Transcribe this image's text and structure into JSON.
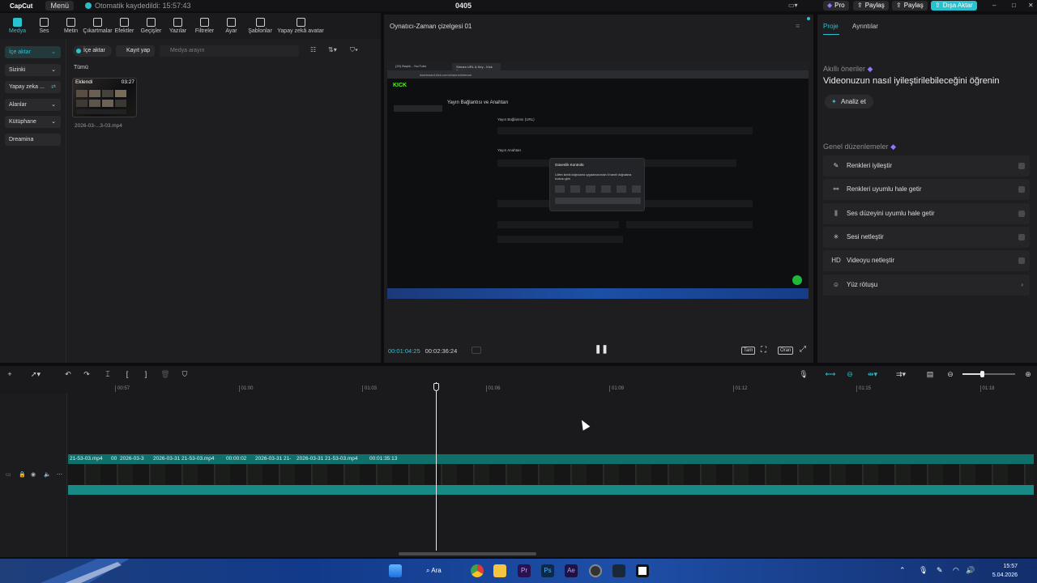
{
  "app": {
    "logo": "CapCut",
    "menu": "Menü",
    "autosave": "Otomatik kaydedildi: 15:57:43",
    "project_title": "0405"
  },
  "topbar_right": {
    "pro": "Pro",
    "share1": "Paylaş",
    "share2": "Paylaş",
    "export": "Dışa Aktar"
  },
  "toolbar": [
    {
      "label": "Medya",
      "icon": "media-icon"
    },
    {
      "label": "Ses",
      "icon": "audio-icon"
    },
    {
      "label": "Metin",
      "icon": "text-icon"
    },
    {
      "label": "Çıkartmalar",
      "icon": "sticker-icon"
    },
    {
      "label": "Efektler",
      "icon": "effects-icon"
    },
    {
      "label": "Geçişler",
      "icon": "transitions-icon"
    },
    {
      "label": "Yazılar",
      "icon": "captions-icon"
    },
    {
      "label": "Filtreler",
      "icon": "filters-icon"
    },
    {
      "label": "Ayar",
      "icon": "adjust-icon"
    },
    {
      "label": "Şablonlar",
      "icon": "templates-icon"
    },
    {
      "label": "Yapay zekâ avatar",
      "icon": "ai-avatar-icon"
    }
  ],
  "sidebar": [
    "İçe aktar",
    "Sizinki",
    "Yapay zeka ...",
    "Alanlar",
    "Kütüphane",
    "Dreamina"
  ],
  "media": {
    "import_label": "İçe aktar",
    "record_label": "Kayıt yap",
    "search_placeholder": "Medya arayın",
    "filter_all": "Tümü",
    "thumb_tag": "Eklendi",
    "thumb_duration": "03:27",
    "thumb_name": "2026-03-...3-03.mp4"
  },
  "player": {
    "title": "Oynatıcı-Zaman çizelgesi 01",
    "current_time": "00:01:04:25",
    "total_time": "00:02:36:24",
    "btn_full": "Tam",
    "btn_ratio": "Oran"
  },
  "right_panel": {
    "tab_project": "Proje",
    "tab_details": "Ayrıntılar",
    "ai_heading": "Akıllı öneriler",
    "ai_title": "Videonuzun nasıl iyileştirilebileceğini öğrenin",
    "analyze": "Analiz et",
    "general_heading": "Genel düzenlemeler",
    "options": [
      {
        "label": "Renkleri iyileştir",
        "icon": "✎"
      },
      {
        "label": "Renkleri uyumlu hale getir",
        "icon": "⚯"
      },
      {
        "label": "Ses düzeyini uyumlu hale getir",
        "icon": "⫼"
      },
      {
        "label": "Sesi netleştir",
        "icon": "✳"
      },
      {
        "label": "Videoyu netleştir",
        "icon": "HD"
      },
      {
        "label": "Yüz rötuşu",
        "icon": "☺"
      }
    ]
  },
  "timeline": {
    "ticks": [
      "00:57",
      "01:00",
      "01:03",
      "01:06",
      "01:09",
      "01:12",
      "01:15",
      "01:18"
    ],
    "clips": [
      "21-53-03.mp4",
      "00",
      "2026-03-3",
      "2026-03-31 21-53-03.mp4",
      "00:00:02",
      "2026-03-31 21-",
      "2026-03-31 21-53-03.mp4",
      "00:01:35:13"
    ]
  },
  "taskbar": {
    "search": "Ara",
    "time": "15:57",
    "date": "5.04.2026"
  },
  "preview": {
    "tab1": "(29) Başlık - YouTube",
    "tab2": "Stream URL & Key - Kick Dash",
    "url": "dashboard.kick.com/channel/stream",
    "page_title": "Yayın Bağlantısı ve Anahtarı",
    "section_url": "Yayın Bağlantısı (URL)",
    "section_key": "Yayın Anahtarı",
    "modal_title": "Güvenlik Kontrolü",
    "modal_text": "Lütfen kimlik doğrulama uygulamasından 6 haneli doğrulama kodunu girin"
  }
}
